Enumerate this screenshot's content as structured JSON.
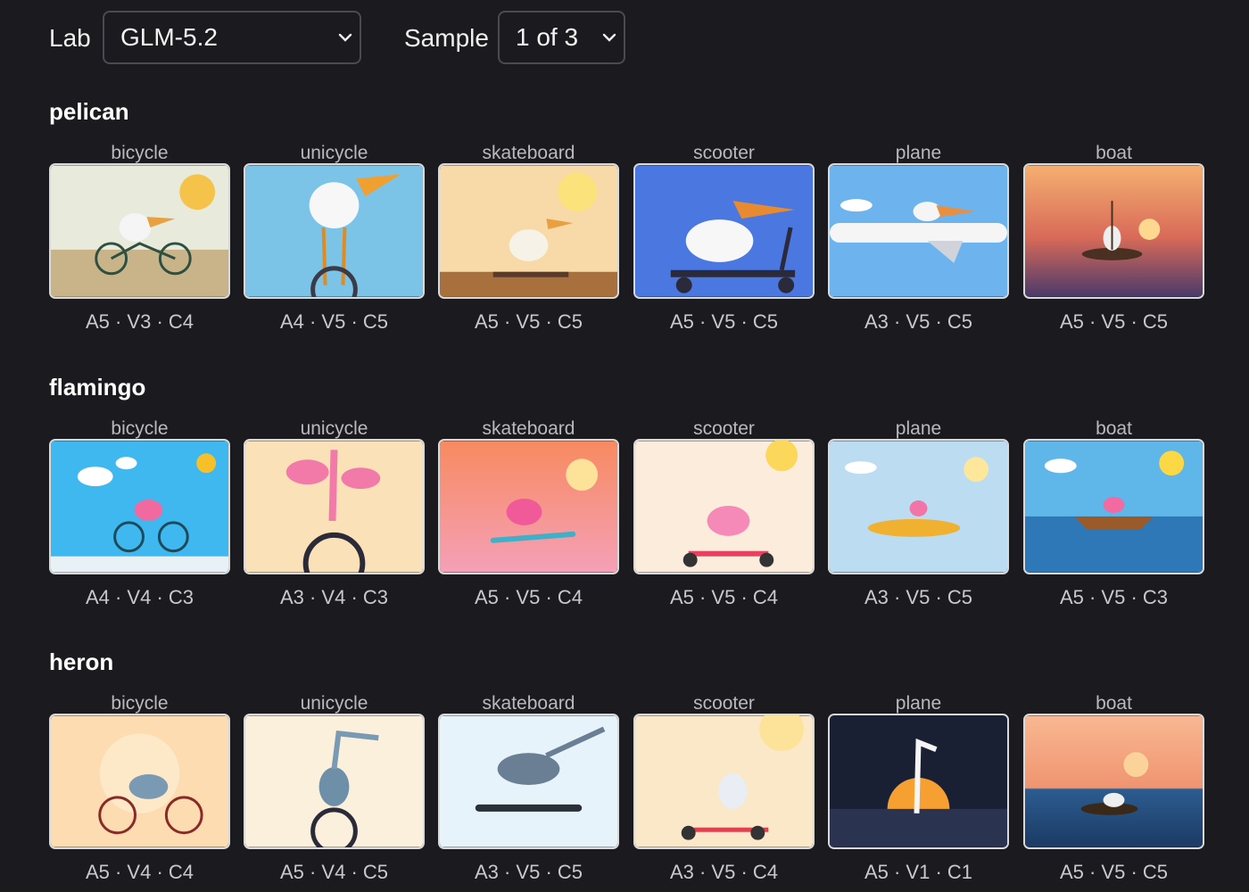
{
  "toolbar": {
    "lab_label": "Lab",
    "lab_value": "GLM-5.2",
    "sample_label": "Sample",
    "sample_value": "1 of 3"
  },
  "groups": [
    {
      "title": "pelican",
      "items": [
        {
          "vehicle": "bicycle",
          "score": "A5 · V3 · C4"
        },
        {
          "vehicle": "unicycle",
          "score": "A4 · V5 · C5"
        },
        {
          "vehicle": "skateboard",
          "score": "A5 · V5 · C5"
        },
        {
          "vehicle": "scooter",
          "score": "A5 · V5 · C5"
        },
        {
          "vehicle": "plane",
          "score": "A3 · V5 · C5"
        },
        {
          "vehicle": "boat",
          "score": "A5 · V5 · C5"
        }
      ]
    },
    {
      "title": "flamingo",
      "items": [
        {
          "vehicle": "bicycle",
          "score": "A4 · V4 · C3"
        },
        {
          "vehicle": "unicycle",
          "score": "A3 · V4 · C3"
        },
        {
          "vehicle": "skateboard",
          "score": "A5 · V5 · C4"
        },
        {
          "vehicle": "scooter",
          "score": "A5 · V5 · C4"
        },
        {
          "vehicle": "plane",
          "score": "A3 · V5 · C5"
        },
        {
          "vehicle": "boat",
          "score": "A5 · V5 · C3"
        }
      ]
    },
    {
      "title": "heron",
      "items": [
        {
          "vehicle": "bicycle",
          "score": "A5 · V4 · C4"
        },
        {
          "vehicle": "unicycle",
          "score": "A5 · V4 · C5"
        },
        {
          "vehicle": "skateboard",
          "score": "A3 · V5 · C5"
        },
        {
          "vehicle": "scooter",
          "score": "A3 · V5 · C4"
        },
        {
          "vehicle": "plane",
          "score": "A5 · V1 · C1"
        },
        {
          "vehicle": "boat",
          "score": "A5 · V5 · C5"
        }
      ]
    }
  ]
}
